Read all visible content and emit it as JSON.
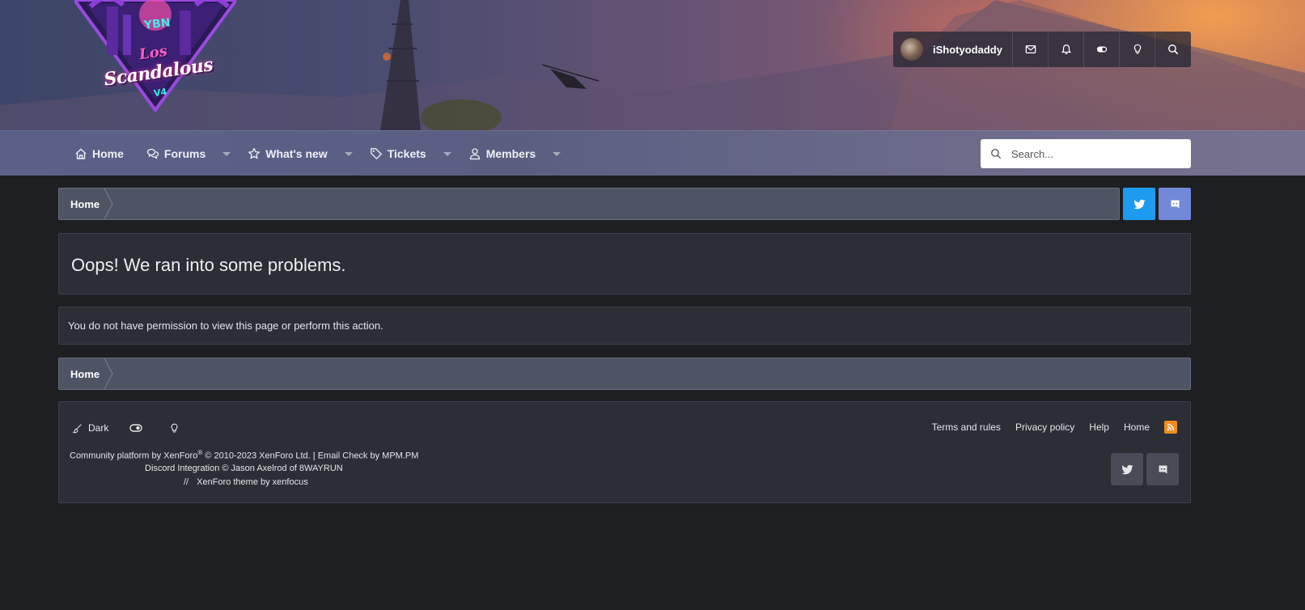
{
  "header": {
    "logo": {
      "ybn": "YBN",
      "los": "Los",
      "scandalous": "Scandalous",
      "version": "V4"
    },
    "user": {
      "username": "iShotyodaddy"
    },
    "user_icons": [
      "envelope-icon",
      "bell-icon",
      "toggle-icon",
      "lightbulb-icon",
      "search-icon"
    ]
  },
  "nav": {
    "items": [
      {
        "label": "Home",
        "icon": "home-icon",
        "has_dropdown": false
      },
      {
        "label": "Forums",
        "icon": "comments-icon",
        "has_dropdown": true
      },
      {
        "label": "What's new",
        "icon": "star-icon",
        "has_dropdown": true
      },
      {
        "label": "Tickets",
        "icon": "tag-icon",
        "has_dropdown": true
      },
      {
        "label": "Members",
        "icon": "user-icon",
        "has_dropdown": true
      }
    ],
    "search_placeholder": "Search..."
  },
  "breadcrumb": {
    "top": "Home",
    "bottom": "Home"
  },
  "social": {
    "twitter_color": "#1d9bf0",
    "discord_color": "#7289da"
  },
  "error": {
    "title": "Oops! We ran into some problems.",
    "message": "You do not have permission to view this page or perform this action."
  },
  "footer": {
    "style_label": "Dark",
    "links": [
      "Terms and rules",
      "Privacy policy",
      "Help",
      "Home"
    ],
    "copyright_line1_a": "Community platform by XenForo",
    "copyright_sup": "®",
    "copyright_line1_b": " © 2010-2023 XenForo Ltd. | Email Check by MPM.PM",
    "copyright_line2": "Discord Integration © Jason Axelrod of 8WAYRUN",
    "copyright_line3_sep": "//",
    "copyright_line3": "XenForo theme by xenfocus"
  },
  "colors": {
    "page_bg": "#1e1f22",
    "panel_bg": "#2c2e36",
    "breadcrumb_bg": "#4e5464",
    "rss": "#f08c1e"
  }
}
